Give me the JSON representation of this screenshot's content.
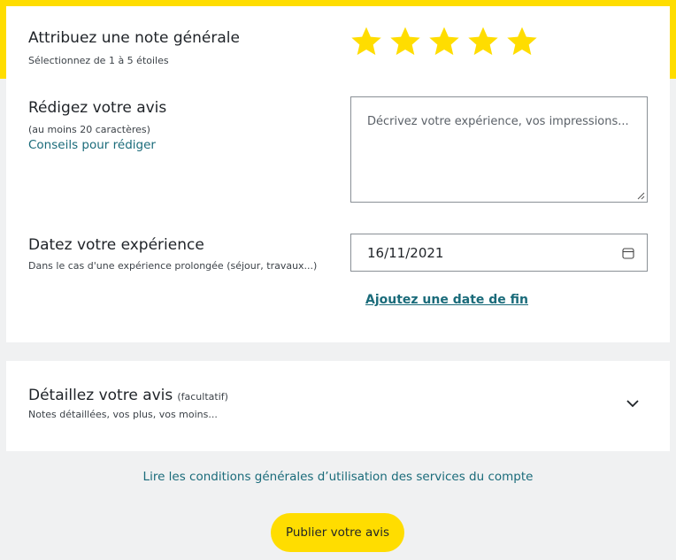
{
  "rating": {
    "title": "Attribuez une note générale",
    "subtitle": "Sélectionnez de 1 à 5 étoiles",
    "value": 5,
    "max": 5,
    "star_color": "#ffdd00"
  },
  "review": {
    "title": "Rédigez votre avis",
    "subtitle": "(au moins 20 caractères)",
    "tips_link": "Conseils pour rédiger",
    "placeholder": "Décrivez votre expérience, vos impressions...",
    "value": ""
  },
  "date": {
    "title": "Datez votre expérience",
    "subtitle": "Dans le cas d'une expérience prolongée (séjour, travaux...)",
    "value": "16/11/2021",
    "add_end_date_link": "Ajoutez une date de fin"
  },
  "details": {
    "title": "Détaillez votre avis",
    "optional": "(facultatif)",
    "subtitle": "Notes détaillées, vos plus, vos moins..."
  },
  "footer": {
    "terms_link": "Lire les conditions générales d’utilisation des services du compte",
    "publish_button": "Publier votre avis"
  },
  "colors": {
    "accent": "#ffdd00",
    "link": "#1a6b7a",
    "background": "#f0f1f2"
  }
}
